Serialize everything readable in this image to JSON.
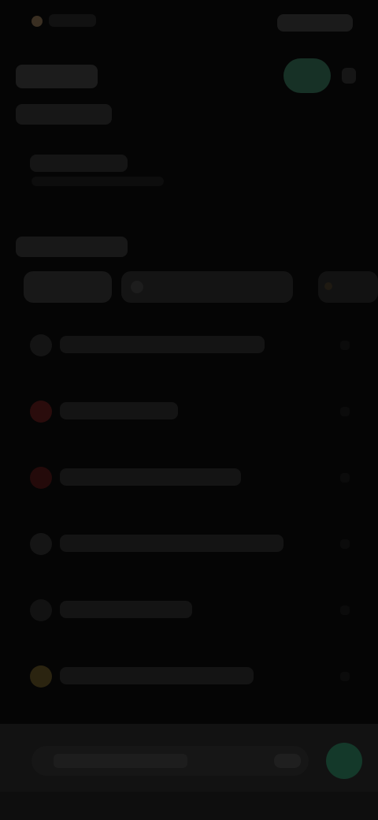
{
  "colors": {
    "background": "#050505",
    "accent_green": "#173126",
    "alert_red": "#2a0c0c",
    "warning_amber": "#2b2410"
  },
  "status_bar": {
    "left_text": "",
    "right_text": ""
  },
  "header": {
    "title": "",
    "subtitle": "",
    "avatar_icon": "avatar-icon",
    "more_icon": "more-vert-icon"
  },
  "info": {
    "line": ""
  },
  "section": {
    "title": ""
  },
  "tabs": [
    {
      "label": ""
    },
    {
      "label": ""
    },
    {
      "label": ""
    }
  ],
  "list": {
    "items": [
      {
        "label": "",
        "icon": "circle-icon",
        "icon_color": "#141414"
      },
      {
        "label": "",
        "icon": "alert-icon",
        "icon_color": "#2a0c0c"
      },
      {
        "label": "",
        "icon": "alert-icon",
        "icon_color": "#240a0a"
      },
      {
        "label": "",
        "icon": "circle-icon",
        "icon_color": "#151515"
      },
      {
        "label": "",
        "icon": "circle-icon",
        "icon_color": "#121212"
      },
      {
        "label": "",
        "icon": "warning-icon",
        "icon_color": "#2b2410"
      }
    ]
  },
  "composer": {
    "placeholder": "",
    "mic_icon": "mic-icon",
    "send_icon": "send-icon"
  }
}
